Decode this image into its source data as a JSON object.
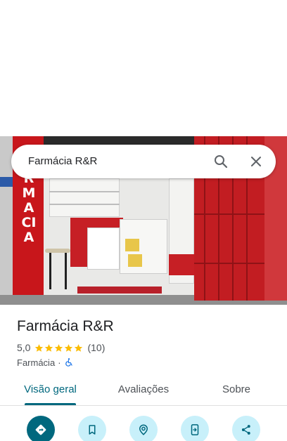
{
  "search": {
    "query": "Farmácia R&R"
  },
  "photo": {
    "sign_text": "RMACIA",
    "description_icon": "storefront-photo"
  },
  "place": {
    "name": "Farmácia R&R",
    "rating": "5,0",
    "stars": 5,
    "review_count": "(10)",
    "category": "Farmácia",
    "separator": "·",
    "accessibility_icon": "wheelchair-icon"
  },
  "tabs": [
    {
      "label": "Visão geral",
      "active": true
    },
    {
      "label": "Avaliações",
      "active": false
    },
    {
      "label": "Sobre",
      "active": false
    }
  ],
  "actions": [
    {
      "name": "directions",
      "icon": "directions-icon"
    },
    {
      "name": "save",
      "icon": "bookmark-icon"
    },
    {
      "name": "nearby",
      "icon": "nearby-icon"
    },
    {
      "name": "send-to-phone",
      "icon": "send-to-phone-icon"
    },
    {
      "name": "share",
      "icon": "share-icon"
    }
  ],
  "colors": {
    "accent": "#00687e",
    "action_bg": "#c8f0fa",
    "star": "#fbbc04",
    "wheelchair": "#1a73e8"
  }
}
